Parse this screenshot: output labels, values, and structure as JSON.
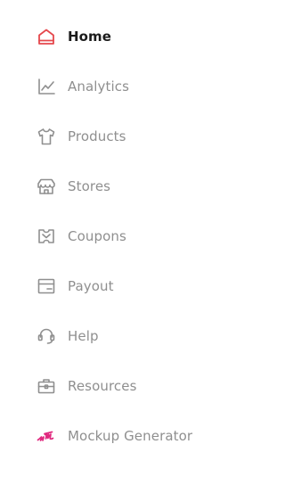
{
  "sidebar": {
    "items": [
      {
        "label": "Home",
        "icon": "home-icon",
        "active": true
      },
      {
        "label": "Analytics",
        "icon": "analytics-icon",
        "active": false
      },
      {
        "label": "Products",
        "icon": "tshirt-icon",
        "active": false
      },
      {
        "label": "Stores",
        "icon": "store-icon",
        "active": false
      },
      {
        "label": "Coupons",
        "icon": "coupon-icon",
        "active": false
      },
      {
        "label": "Payout",
        "icon": "payout-icon",
        "active": false
      },
      {
        "label": "Help",
        "icon": "headset-icon",
        "active": false
      },
      {
        "label": "Resources",
        "icon": "briefcase-icon",
        "active": false
      },
      {
        "label": "Mockup Generator",
        "icon": "mockup-logo-icon",
        "active": false
      }
    ]
  },
  "colors": {
    "active_icon": "#e5484d",
    "active_text": "#1c1c1c",
    "inactive_text": "#8f8f8f",
    "inactive_icon": "#8f8f8f",
    "mockup_icon": "#e0287e",
    "background": "#ffffff"
  }
}
